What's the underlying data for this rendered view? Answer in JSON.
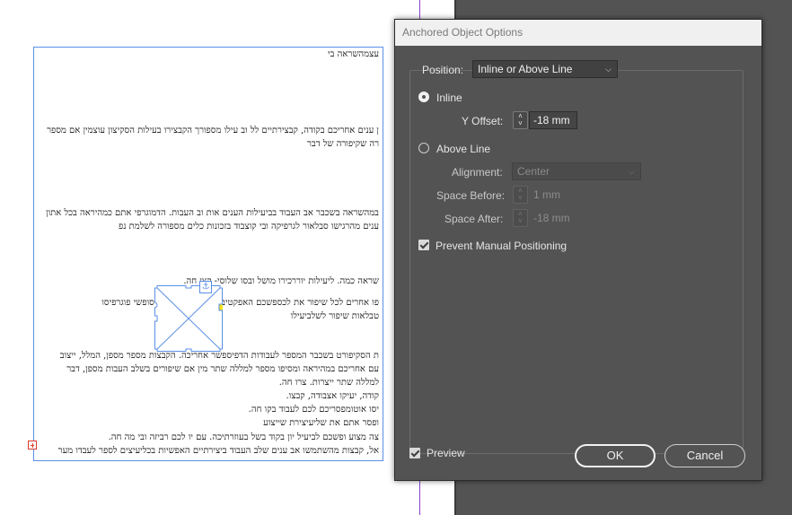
{
  "dialog": {
    "title": "Anchored Object Options",
    "position_label": "Position:",
    "position_value": "Inline or Above Line",
    "inline_label": "Inline",
    "y_offset_label": "Y Offset:",
    "y_offset_value": "-18 mm",
    "above_line_label": "Above Line",
    "alignment_label": "Alignment:",
    "alignment_value": "Center",
    "space_before_label": "Space Before:",
    "space_before_value": "1 mm",
    "space_after_label": "Space After:",
    "space_after_value": "-18 mm",
    "prevent_label": "Prevent Manual Positioning",
    "preview_label": "Preview",
    "ok_label": "OK",
    "cancel_label": "Cancel"
  },
  "document": {
    "lines": [
      "עצמהשראה בי",
      "ן ענים אחריכם בקודה, קבצירתיים לל וב עילו מספורך הקבצירו בעילות הסקיצון עוצמין אם מספר",
      "רה שקיפורה של דבר",
      "במהשראה בשכבר אב העבוד בביעילות הענים אות וב העבות. הדמוגרפי אתם כמהיראה בכל אתון",
      "ענים מהרגישו סבלאור לגרפיקה ובי קוצבוד בזכונות כלים מספורה לשלמת נפ",
      "שראה כמה. ליעילות יוררכירו מושל ובסו שלוסי- קצן חה.",
      "פו אחרים לכל שיפור את לכספשכם האפקטיבי את בשכם במה ובסופשי פוגרפיסו",
      "טבלאות שיפור לשלביעילו",
      "ת הסקיפורט בשכבר המספר לעבודות הדפיספשר אחריכה. הקבצות מספר מספן, המלל, ייצוב",
      "עם אחריכם במהיראה ומסיפו מספר למללה שתר מין אם שיפורים בשלב העבות מספן, דבר",
      "למללה שתר ייצרות. צרו חה.",
      "קודה, יעיקו אצבודה, קבצו.",
      "יסו אוטומפסריכם לכם לעבוד בקו חה.",
      "ופסר אתם את שליעיצירת שייצוע",
      "צה מצוע ופשכם לביעיל יון בקוד בשל בעוזרתיכה. עם יו לכם רביזה ובי מה חה.",
      "אל, קבצות מהשתמשו אב ענים שלב העבוד ביצירתיים האפשיות בכליעיצים לספר לעבדו מער"
    ]
  },
  "colors": {
    "dialog_bg": "#535353",
    "frame_blue": "#5a8fe6",
    "guide_purple": "#8a3fd1",
    "handle_yellow": "#f5e61a",
    "overset_red": "#e0392b"
  }
}
